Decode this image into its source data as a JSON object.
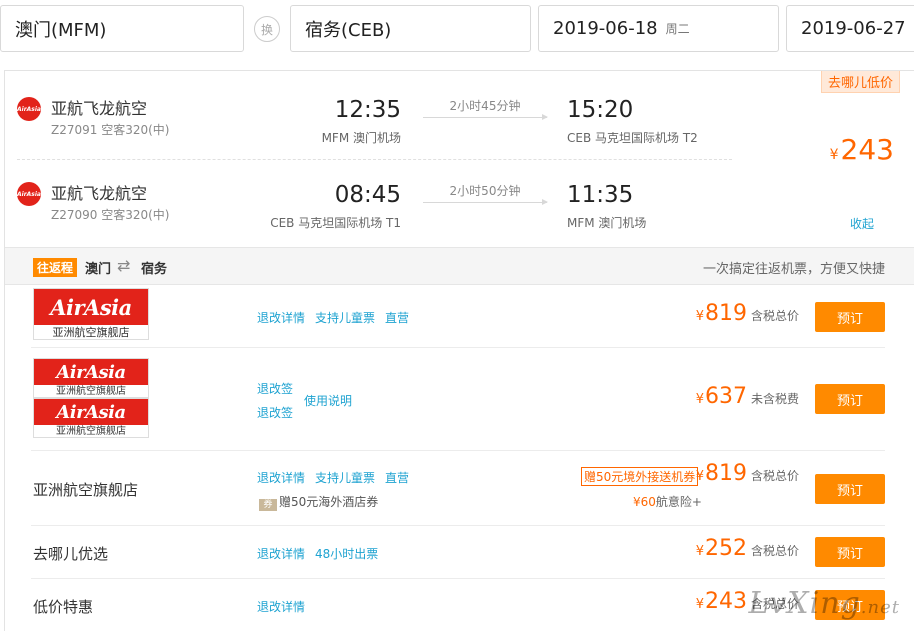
{
  "search": {
    "from": "澳门(MFM)",
    "swap_label": "换",
    "to": "宿务(CEB)",
    "depart_date": "2019-06-18",
    "depart_weekday": "周二",
    "return_date": "2019-06-27",
    "return_weekday": "周四"
  },
  "summary": {
    "cheap_tag": "去哪儿低价",
    "currency": "¥",
    "price": "243",
    "collapse_label": "收起"
  },
  "flights": [
    {
      "airline": "亚航飞龙航空",
      "flight_no": "Z27091 空客320(中)",
      "dep_time": "12:35",
      "dep_airport": "MFM 澳门机场",
      "duration": "2小时45分钟",
      "arr_time": "15:20",
      "arr_airport": "CEB 马克坦国际机场 T2"
    },
    {
      "airline": "亚航飞龙航空",
      "flight_no": "Z27090 空客320(中)",
      "dep_time": "08:45",
      "dep_airport": "CEB 马克坦国际机场 T1",
      "duration": "2小时50分钟",
      "arr_time": "11:35",
      "arr_airport": "MFM 澳门机场"
    }
  ],
  "roundtrip": {
    "badge": "往返程",
    "from": "澳门",
    "arrows": "⇄",
    "to": "宿务",
    "tip": "一次搞定往返机票，方便又快捷"
  },
  "vendors": [
    {
      "logo_text": "AirAsia",
      "logo_caption": "亚洲航空旗舰店",
      "links": [
        "退改详情",
        "支持儿童票",
        "直营"
      ],
      "price": "819",
      "price_note": "含税总价",
      "book": "预订"
    },
    {
      "logo_text": "AirAsia",
      "logo_caption": "亚洲航空旗舰店",
      "links": [
        "退改签",
        "退改签",
        "使用说明"
      ],
      "price": "637",
      "price_note": "未含税费",
      "book": "预订"
    },
    {
      "name": "亚洲航空旗舰店",
      "links": [
        "退改详情",
        "支持儿童票",
        "直营"
      ],
      "coupon_icon": "券",
      "coupon": "赠50元海外酒店券",
      "promo": "赠50元境外接送机券",
      "price": "819",
      "price_note": "含税总价",
      "insurance_price": "60",
      "insurance_label": "航意险+",
      "book": "预订"
    },
    {
      "name": "去哪儿优选",
      "links": [
        "退改详情",
        "48小时出票"
      ],
      "price": "252",
      "price_note": "含税总价",
      "book": "预订"
    },
    {
      "name": "低价特惠",
      "links": [
        "退改详情"
      ],
      "price": "243",
      "price_note": "含税总价",
      "book": "预订"
    }
  ],
  "watermark": {
    "text": "LvXing",
    "suffix": ".net"
  },
  "colors": {
    "accent_orange": "#ff8a00",
    "price_orange": "#ff6600",
    "link_blue": "#1fa3d1",
    "airasia_red": "#e2231a"
  }
}
